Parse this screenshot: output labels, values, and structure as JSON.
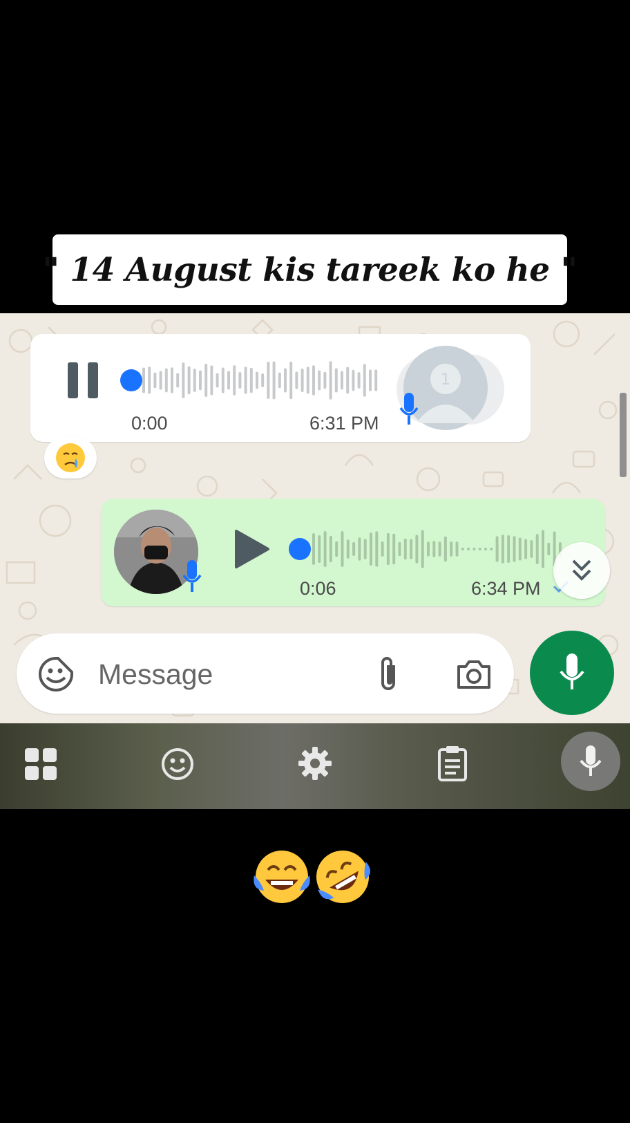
{
  "caption": {
    "text": "\" 14 August kis tareek ko he \""
  },
  "incoming_voice": {
    "elapsed": "0:00",
    "time": "6:31 PM",
    "state": "playing",
    "progress": 0.0,
    "avatar_icon": "default-avatar-icon",
    "reaction_icon": "crying-face-emoji"
  },
  "outgoing_voice": {
    "elapsed": "0:06",
    "time": "6:34 PM",
    "state": "paused",
    "progress": 0.0,
    "status_icon": "single-check-icon"
  },
  "composer": {
    "placeholder": "Message",
    "emoji_icon": "sticker-icon",
    "attach_icon": "paperclip-icon",
    "camera_icon": "camera-icon",
    "send_icon": "microphone-icon"
  },
  "keyboard_toolbar": {
    "icons": [
      "apps-grid-icon",
      "emoji-icon",
      "settings-gear-icon",
      "clipboard-icon",
      "voice-input-icon"
    ]
  },
  "bottom_emojis": [
    "face-with-tears-of-joy-emoji",
    "rolling-on-floor-laughing-emoji"
  ],
  "colors": {
    "chat_background": "#efeae2",
    "outgoing_bubble": "#d3f8cf",
    "accent_green": "#0b8a4d",
    "progress_blue": "#1a73ff"
  }
}
